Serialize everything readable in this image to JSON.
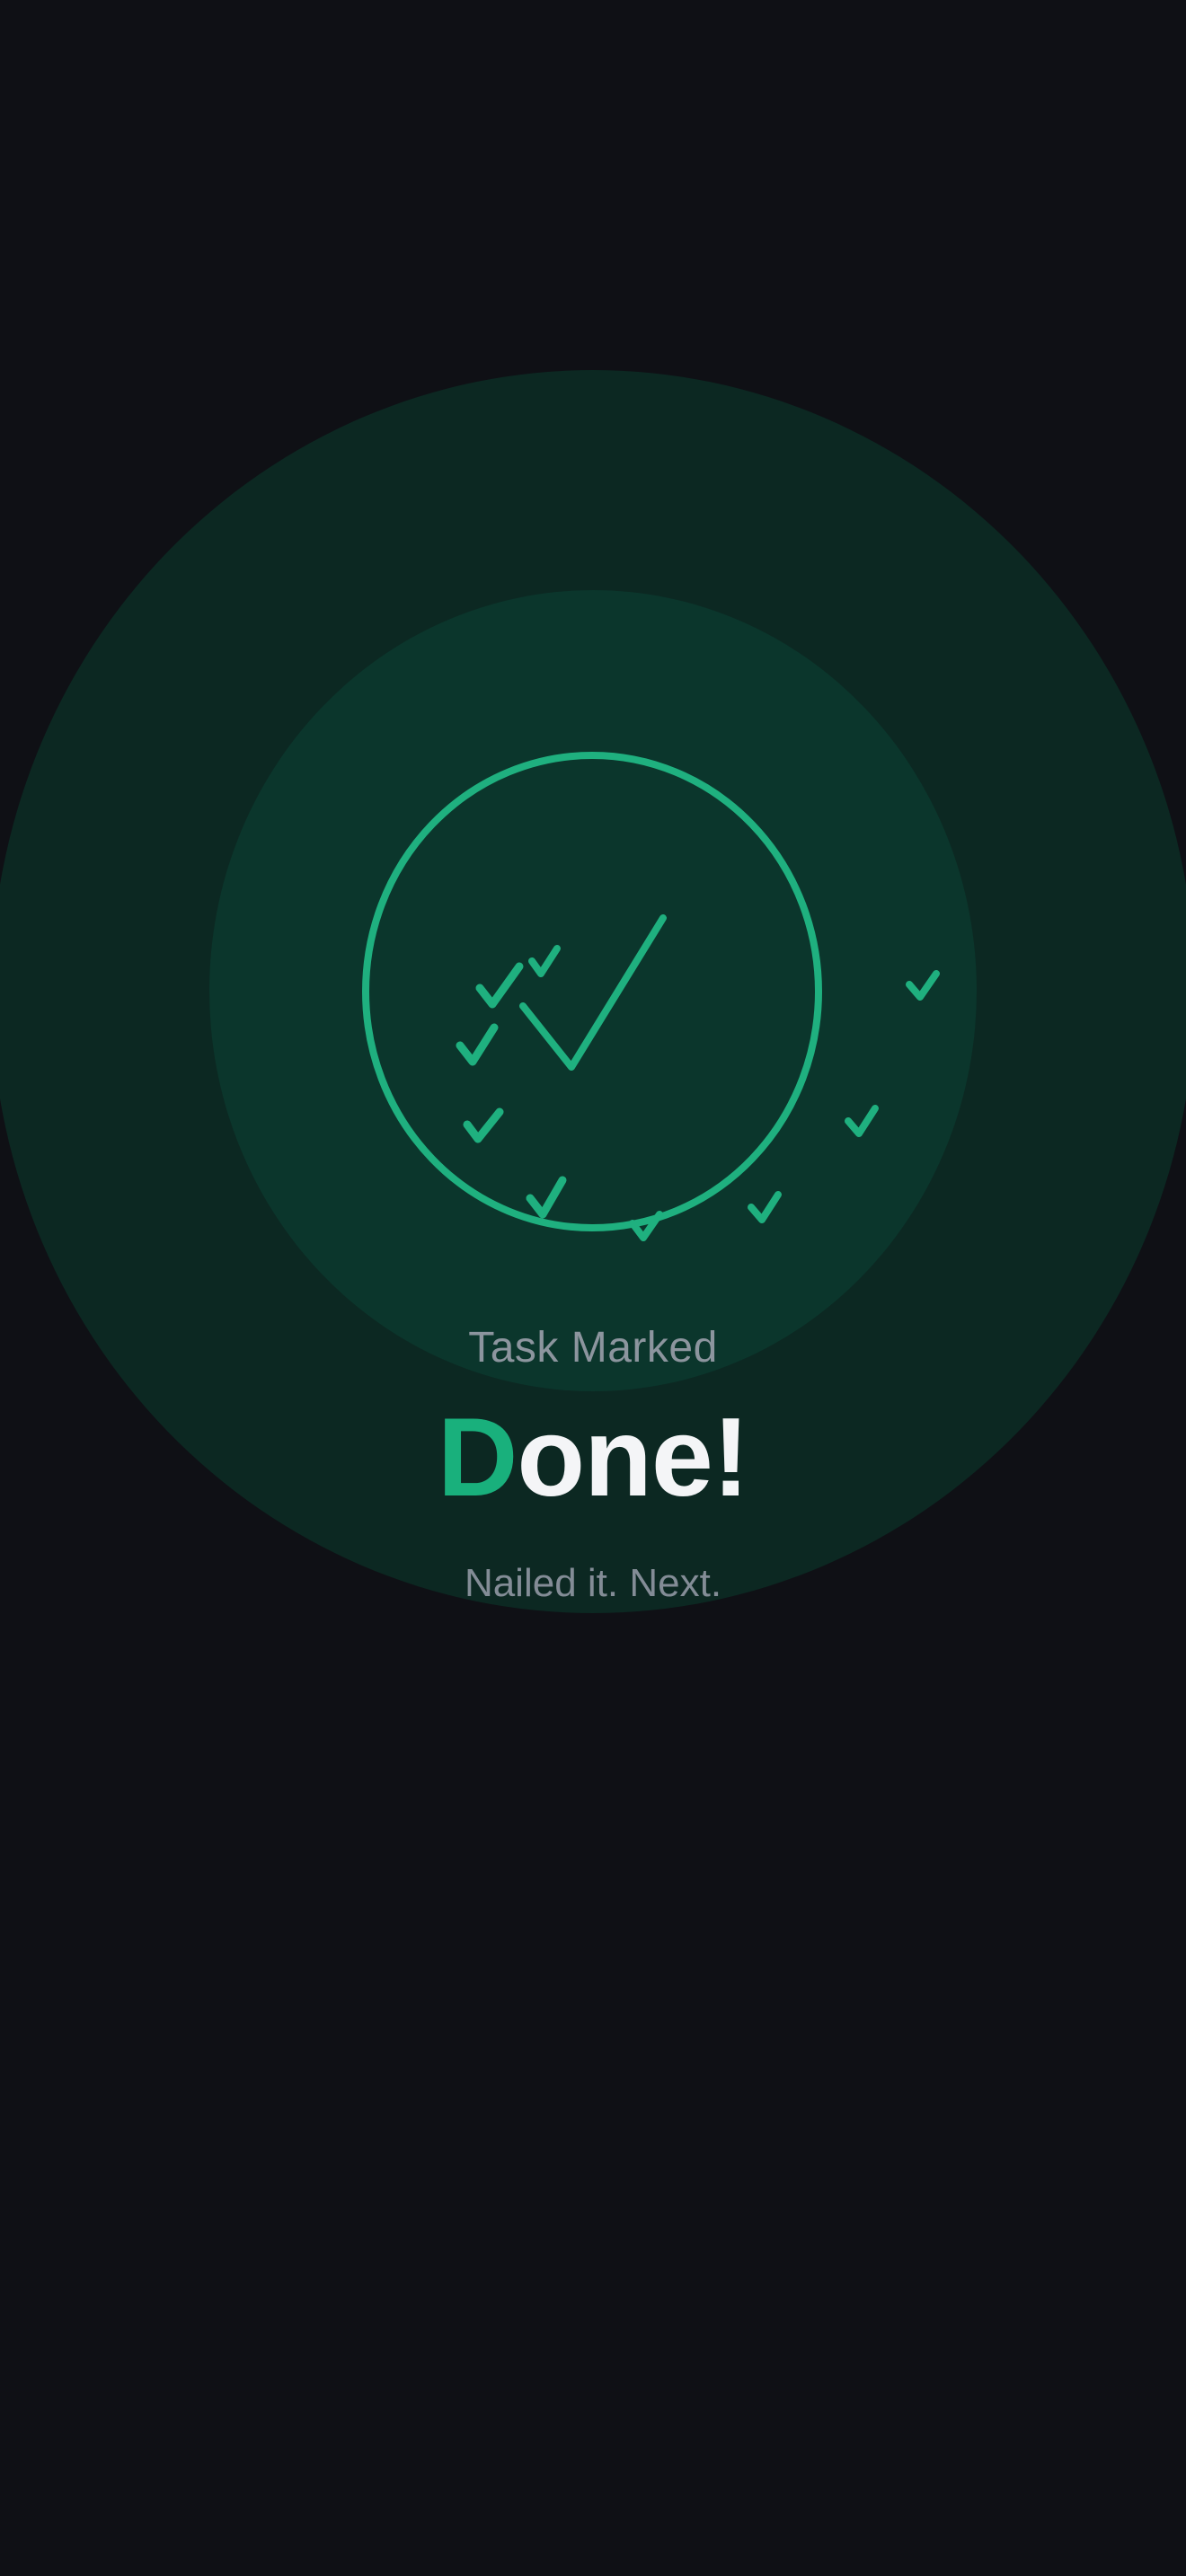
{
  "colors": {
    "background": "#0f1015",
    "glow_outer": "#0c2822",
    "glow_inner": "#0b362c",
    "accent": "#19b07c",
    "stroke": "#1fb07f",
    "headline": "#f4f5f7",
    "muted": "#8c959e"
  },
  "icons": {
    "hero": "circle-check-icon",
    "confetti": "checkmark-icon"
  },
  "completion": {
    "eyebrow": "Task Marked",
    "headline_first_letter": "D",
    "headline_rest": "one!",
    "subtitle": "Nailed it. Next."
  }
}
